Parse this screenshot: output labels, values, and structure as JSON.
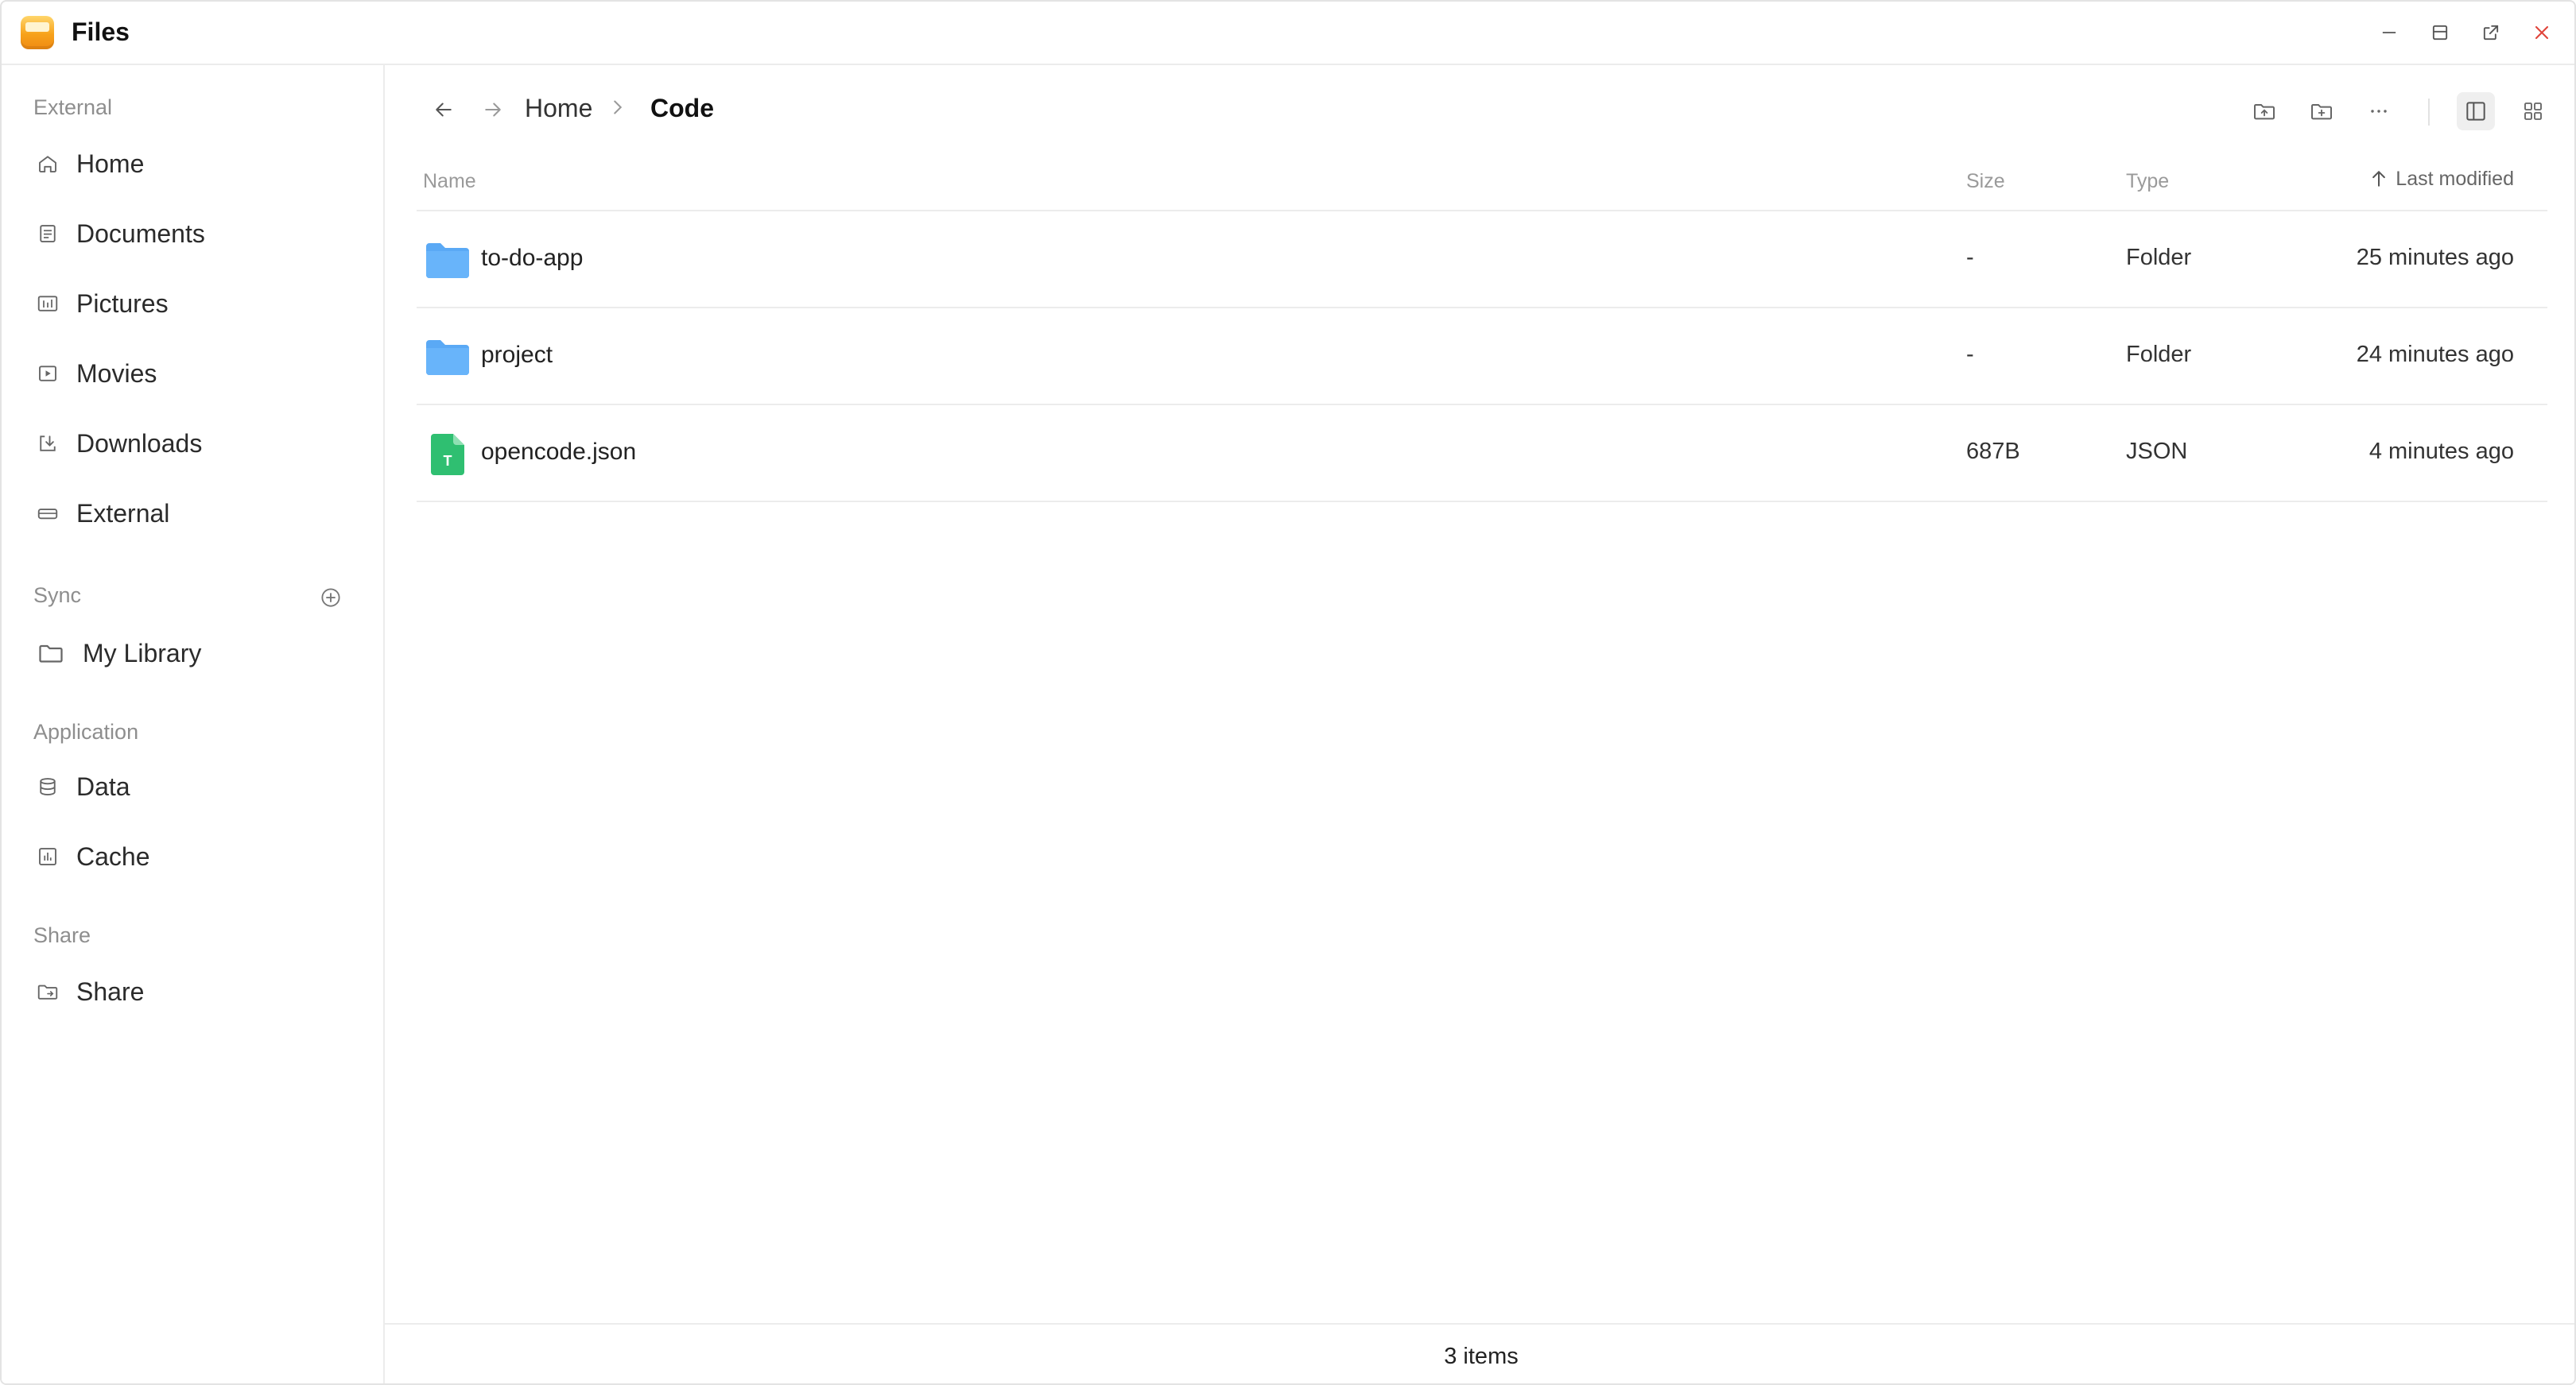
{
  "window": {
    "title": "Files"
  },
  "sidebar": {
    "sections": [
      {
        "label": "External"
      },
      {
        "label": "Sync"
      },
      {
        "label": "Application"
      },
      {
        "label": "Share"
      }
    ],
    "items": [
      {
        "label": "Home",
        "icon": "home-icon"
      },
      {
        "label": "Documents",
        "icon": "document-icon"
      },
      {
        "label": "Pictures",
        "icon": "pictures-icon"
      },
      {
        "label": "Movies",
        "icon": "movie-icon"
      },
      {
        "label": "Downloads",
        "icon": "download-icon"
      },
      {
        "label": "External",
        "icon": "drive-icon"
      },
      {
        "label": "My Library",
        "icon": "folder-icon"
      },
      {
        "label": "Data",
        "icon": "database-icon"
      },
      {
        "label": "Cache",
        "icon": "cache-icon"
      },
      {
        "label": "Share",
        "icon": "share-folder-icon"
      }
    ]
  },
  "breadcrumb": {
    "items": [
      "Home",
      "Code"
    ]
  },
  "table": {
    "columns": {
      "name": "Name",
      "size": "Size",
      "type": "Type",
      "modified": "Last modified"
    },
    "rows": [
      {
        "name": "to-do-app",
        "size": "-",
        "type": "Folder",
        "modified": "25 minutes ago",
        "icon": "folder-icon"
      },
      {
        "name": "project",
        "size": "-",
        "type": "Folder",
        "modified": "24 minutes ago",
        "icon": "folder-icon"
      },
      {
        "name": "opencode.json",
        "size": "687B",
        "type": "JSON",
        "modified": "4 minutes ago",
        "icon": "text-file-icon"
      }
    ]
  },
  "footer": {
    "count": "3 items"
  },
  "colors": {
    "accent_folder": "#5aa9f5",
    "file_green": "#2fbf71",
    "close_red": "#e0443a"
  }
}
